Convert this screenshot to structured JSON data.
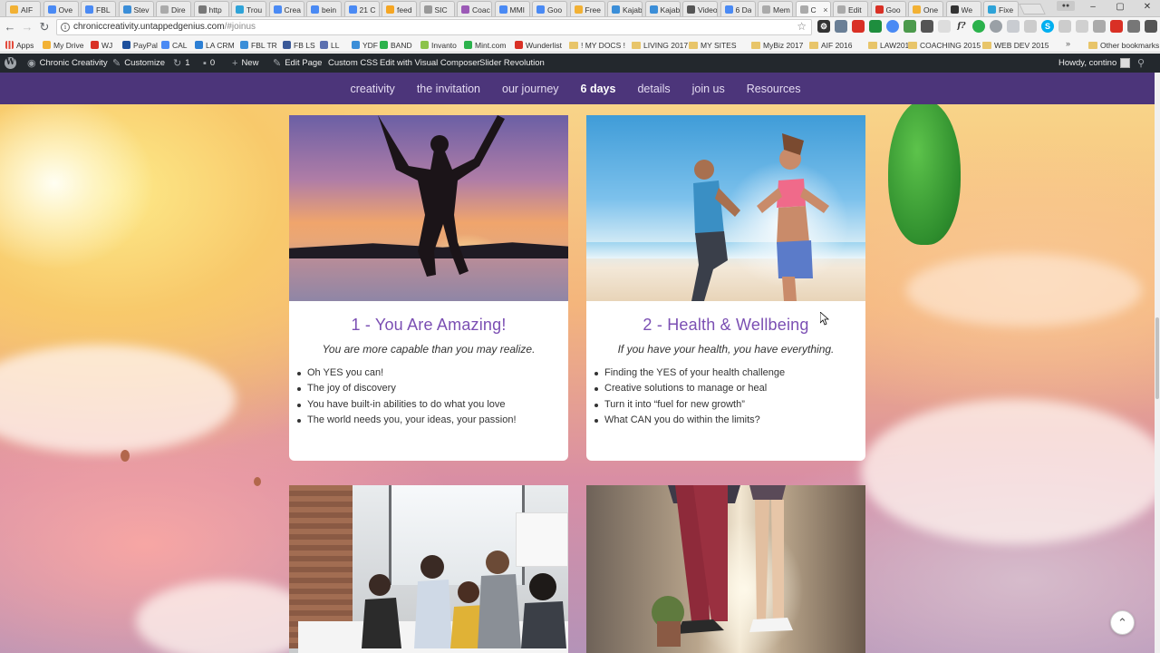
{
  "browser": {
    "tabs": [
      {
        "label": "AIF",
        "color": "#f2b134"
      },
      {
        "label": "Ove",
        "color": "#4a8af4"
      },
      {
        "label": "FBL",
        "color": "#4a8af4"
      },
      {
        "label": "Stev",
        "color": "#3b8ed8"
      },
      {
        "label": "Dire",
        "color": "#aaaaaa"
      },
      {
        "label": "http",
        "color": "#777777"
      },
      {
        "label": "Trou",
        "color": "#2ea3d8"
      },
      {
        "label": "Crea",
        "color": "#4a8af4"
      },
      {
        "label": "bein",
        "color": "#4a8af4"
      },
      {
        "label": "21 C",
        "color": "#4a8af4"
      },
      {
        "label": "feed",
        "color": "#f5a623"
      },
      {
        "label": "SIC",
        "color": "#999999"
      },
      {
        "label": "Coac",
        "color": "#9b59b6"
      },
      {
        "label": "MMI",
        "color": "#4a8af4"
      },
      {
        "label": "Goo",
        "color": "#4a8af4"
      },
      {
        "label": "Free",
        "color": "#f2b134"
      },
      {
        "label": "Kajab",
        "color": "#3b8ed8"
      },
      {
        "label": "Kajab",
        "color": "#3b8ed8"
      },
      {
        "label": "Video",
        "color": "#555555"
      },
      {
        "label": "6 Da",
        "color": "#4a8af4"
      },
      {
        "label": "Mem",
        "color": "#aaaaaa"
      },
      {
        "label": "C",
        "color": "#aaaaaa"
      },
      {
        "label": "Edit",
        "color": "#aaaaaa"
      },
      {
        "label": "Goo",
        "color": "#d93025"
      },
      {
        "label": "One",
        "color": "#f2b134"
      },
      {
        "label": "We",
        "color": "#333333"
      },
      {
        "label": "Fixe",
        "color": "#2ea3d8"
      }
    ],
    "active_tab_index": 21,
    "url_domain": "chroniccreativity.untappedgenius.com",
    "url_path": "/#joinus",
    "window": {
      "minimize": "–",
      "maximize": "▢",
      "close": "✕"
    }
  },
  "bookmarks": [
    {
      "label": "Apps",
      "kind": "apps",
      "color": "#e34b3c"
    },
    {
      "label": "My Drive",
      "kind": "icon",
      "color": "#f2b134"
    },
    {
      "label": "WJ",
      "kind": "icon",
      "color": "#d93025"
    },
    {
      "label": "PayPal",
      "kind": "icon",
      "color": "#1c4f9c"
    },
    {
      "label": "CAL",
      "kind": "icon",
      "color": "#4a8af4"
    },
    {
      "label": "LA CRM",
      "kind": "icon",
      "color": "#2c7fd4"
    },
    {
      "label": "FBL TR",
      "kind": "icon",
      "color": "#3b8ed8"
    },
    {
      "label": "FB LS",
      "kind": "icon",
      "color": "#3b5998"
    },
    {
      "label": "LL",
      "kind": "icon",
      "color": "#5b6fb0"
    },
    {
      "label": "YDF",
      "kind": "icon",
      "color": "#3b8ed8"
    },
    {
      "label": "BAND",
      "kind": "icon",
      "color": "#2bb24c"
    },
    {
      "label": "Invanto",
      "kind": "icon",
      "color": "#8bc34a"
    },
    {
      "label": "Mint.com",
      "kind": "icon",
      "color": "#2bb24c"
    },
    {
      "label": "Wunderlist",
      "kind": "icon",
      "color": "#d93025"
    },
    {
      "label": "! MY DOCS !",
      "kind": "folder"
    },
    {
      "label": "LIVING 2017",
      "kind": "folder"
    },
    {
      "label": "MY SITES",
      "kind": "folder"
    },
    {
      "label": "MyBiz 2017",
      "kind": "folder"
    },
    {
      "label": "AIF 2016",
      "kind": "folder"
    },
    {
      "label": "LAW2015",
      "kind": "folder"
    },
    {
      "label": "COACHING 2015",
      "kind": "folder"
    },
    {
      "label": "WEB DEV 2015",
      "kind": "folder"
    }
  ],
  "bookmarks_more": "»",
  "other_bookmarks": "Other bookmarks",
  "adminbar": {
    "site_name": "Chronic Creativity",
    "customize": "Customize",
    "updates_count": "1",
    "comments_count": "0",
    "new": "New",
    "edit_page": "Edit Page",
    "custom_css": "Custom CSS",
    "visual_composer": "Edit with Visual Composer",
    "slider_revolution": "Slider Revolution",
    "howdy": "Howdy, contino"
  },
  "site_nav": {
    "items": [
      "creativity",
      "the invitation",
      "our journey",
      "6 days",
      "details",
      "join us",
      "Resources"
    ],
    "current_index": 3
  },
  "cards": [
    {
      "title": "1 - You Are Amazing!",
      "subtitle": "You are more capable than you may realize.",
      "bullets": [
        "Oh YES you can!",
        "The joy of discovery",
        "You have built-in abilities to do what you love",
        "The world needs you, your ideas, your passion!"
      ]
    },
    {
      "title": "2 - Health & Wellbeing",
      "subtitle": "If you have your health, you have everything.",
      "bullets": [
        "Finding the YES of your health challenge",
        "Creative solutions to manage or heal",
        "Turn it into “fuel for new growth”",
        "What CAN you do within the limits?"
      ]
    }
  ],
  "colors": {
    "nav_bg": "#4c357a",
    "card_title": "#7b4fb3",
    "adminbar_bg": "#23282d"
  }
}
